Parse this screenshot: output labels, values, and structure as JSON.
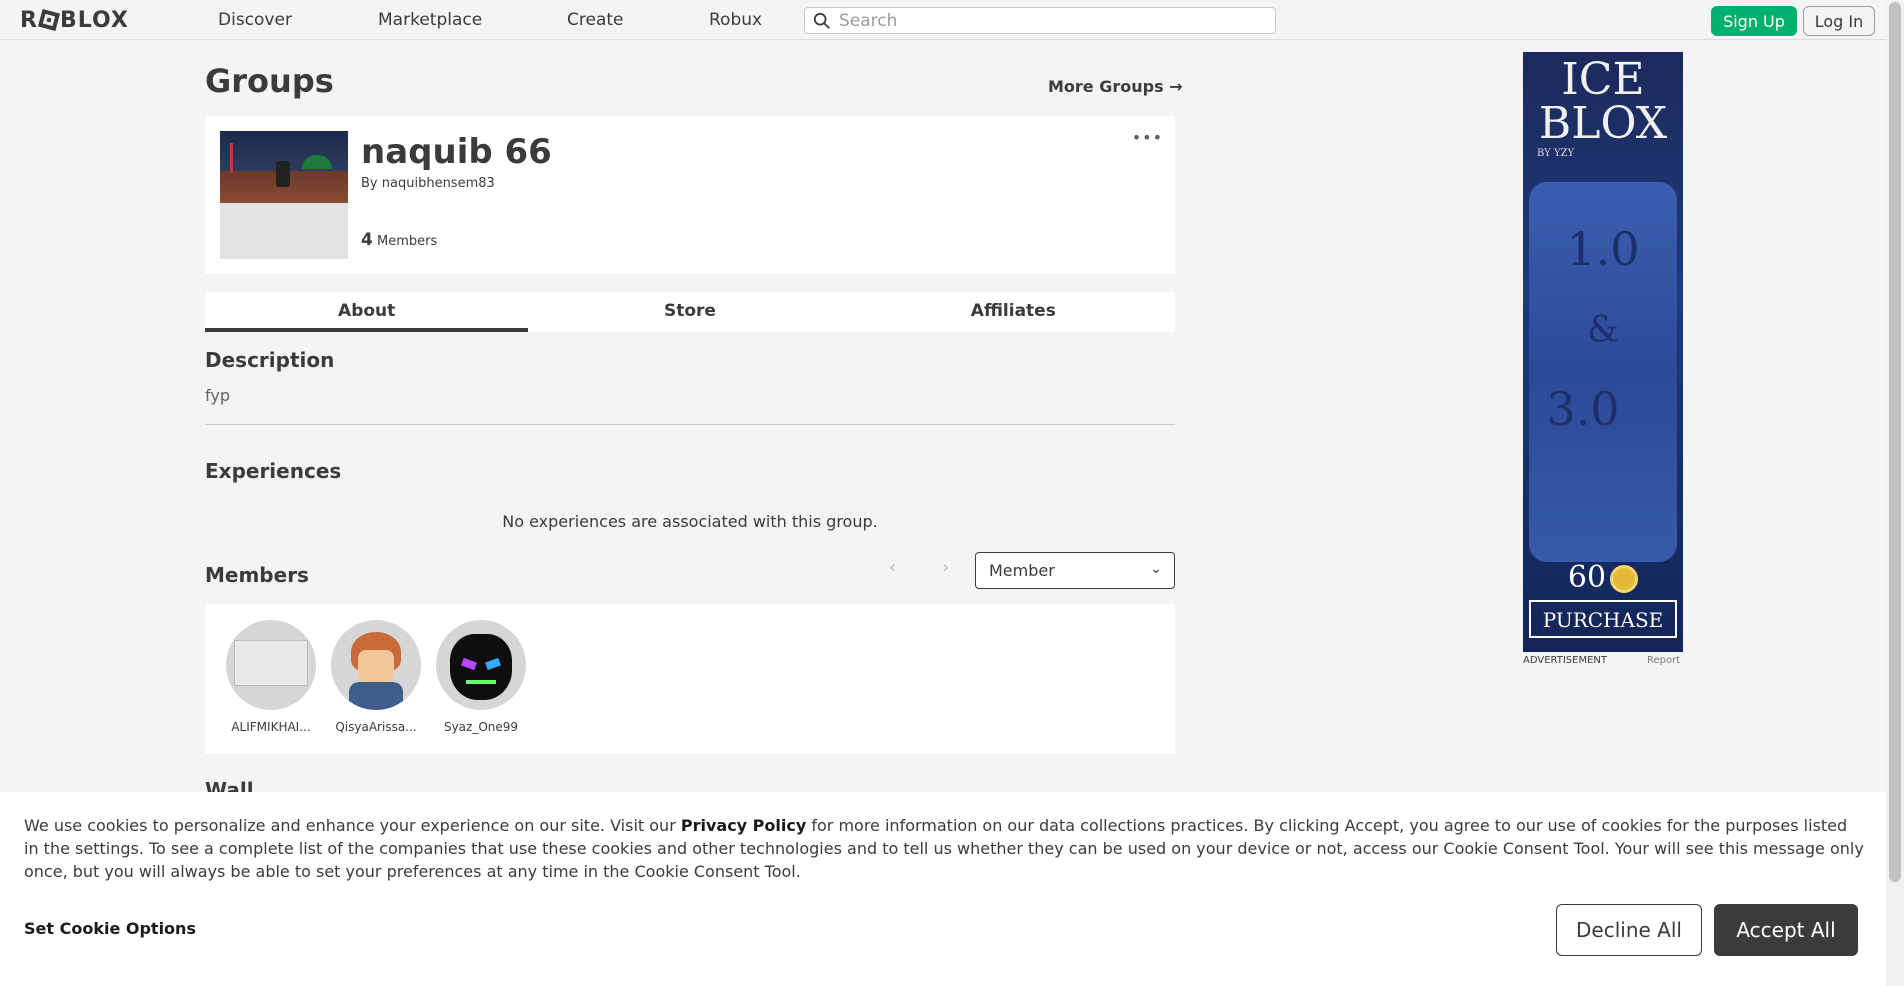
{
  "nav": {
    "logo_text": "ROBLOX",
    "links": [
      "Discover",
      "Marketplace",
      "Create",
      "Robux"
    ],
    "search_placeholder": "Search",
    "signup_label": "Sign Up",
    "login_label": "Log In"
  },
  "page": {
    "title": "Groups",
    "more_groups": "More Groups →"
  },
  "group": {
    "name": "naquib 66",
    "by_prefix": "By",
    "owner": "naquibhensem83",
    "member_count": "4",
    "member_count_label": "Members",
    "menu_glyph": "•••"
  },
  "tabs": [
    "About",
    "Store",
    "Affiliates"
  ],
  "about": {
    "description_title": "Description",
    "description_text": "fyp",
    "experiences_title": "Experiences",
    "no_experiences": "No experiences are associated with this group.",
    "members_title": "Members",
    "role_selected": "Member",
    "members": [
      {
        "name": "ALIFMIKHAI..."
      },
      {
        "name": "QisyaArissa..."
      },
      {
        "name": "Syaz_One99"
      }
    ],
    "wall_title": "Wall"
  },
  "ad": {
    "title_line1": "ICE",
    "title_line2": "BLOX",
    "byline": "BY YZY",
    "version1": "1.0",
    "amp": "&",
    "version2": "3.0",
    "price": "60",
    "cta": "PURCHASE",
    "label": "ADVERTISEMENT",
    "report": "Report"
  },
  "cookie": {
    "text_before": "We use cookies to personalize and enhance your experience on our site. Visit our ",
    "privacy_link": "Privacy Policy",
    "text_after": " for more information on our data collections practices. By clicking Accept, you agree to our use of cookies for the purposes listed in the settings. To see a complete list of the companies that use these cookies and other technologies and to tell us whether they can be used on your device or not, access our Cookie Consent Tool. Your will see this message only once, but you will always be able to set your preferences at any time in the Cookie Consent Tool.",
    "options_label": "Set Cookie Options",
    "decline_label": "Decline All",
    "accept_label": "Accept All"
  },
  "colors": {
    "signup_green": "#00b06f",
    "text_dark": "#393b3d",
    "background": "#f2f4f5"
  }
}
